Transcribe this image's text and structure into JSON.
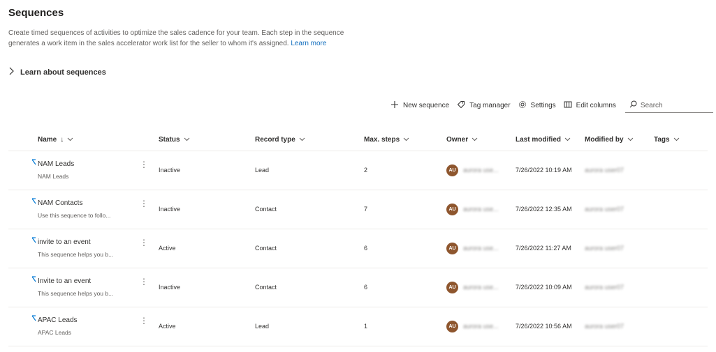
{
  "page": {
    "title": "Sequences",
    "description": "Create timed sequences of activities to optimize the sales cadence for your team. Each step in the sequence generates a work item in the sales accelerator work list for the seller to whom it's assigned.",
    "learn_more_link": "Learn more",
    "learn_about": "Learn about sequences"
  },
  "toolbar": {
    "new_sequence": "New sequence",
    "tag_manager": "Tag manager",
    "settings": "Settings",
    "edit_columns": "Edit columns",
    "search_placeholder": "Search"
  },
  "table": {
    "columns": [
      "Name",
      "Status",
      "Record type",
      "Max. steps",
      "Owner",
      "Last modified",
      "Modified by",
      "Tags"
    ],
    "name_sort_glyph": "↓",
    "rows": [
      {
        "name": "NAM Leads",
        "subtitle": "NAM Leads",
        "status": "Inactive",
        "record_type": "Lead",
        "max_steps": "2",
        "owner_initials": "AU",
        "owner": "aurora use...",
        "last_modified": "7/26/2022 10:19 AM",
        "modified_by": "aurora user07",
        "tags": ""
      },
      {
        "name": "NAM Contacts",
        "subtitle": "Use this sequence to follo...",
        "status": "Inactive",
        "record_type": "Contact",
        "max_steps": "7",
        "owner_initials": "AU",
        "owner": "aurora use...",
        "last_modified": "7/26/2022 12:35 AM",
        "modified_by": "aurora user07",
        "tags": ""
      },
      {
        "name": "invite to an event",
        "subtitle": "This sequence helps you b...",
        "status": "Active",
        "record_type": "Contact",
        "max_steps": "6",
        "owner_initials": "AU",
        "owner": "aurora use...",
        "last_modified": "7/26/2022 11:27 AM",
        "modified_by": "aurora user07",
        "tags": ""
      },
      {
        "name": "Invite to an event",
        "subtitle": "This sequence helps you b...",
        "status": "Inactive",
        "record_type": "Contact",
        "max_steps": "6",
        "owner_initials": "AU",
        "owner": "aurora use...",
        "last_modified": "7/26/2022 10:09 AM",
        "modified_by": "aurora user07",
        "tags": ""
      },
      {
        "name": "APAC Leads",
        "subtitle": "APAC Leads",
        "status": "Active",
        "record_type": "Lead",
        "max_steps": "1",
        "owner_initials": "AU",
        "owner": "aurora use...",
        "last_modified": "7/26/2022 10:56 AM",
        "modified_by": "aurora user07",
        "tags": ""
      }
    ]
  },
  "colors": {
    "link": "#0f6cbd",
    "avatar": "#8e562e",
    "sequence_icon": "#0078d4"
  },
  "icons": {
    "new_sequence": "plus-icon",
    "tag_manager": "tag-icon",
    "settings": "gear-icon",
    "edit_columns": "columns-icon",
    "search": "search-icon",
    "expand": "chevron-right-icon",
    "sequence": "sequence-icon",
    "row_menu": "more-vertical-icon"
  }
}
